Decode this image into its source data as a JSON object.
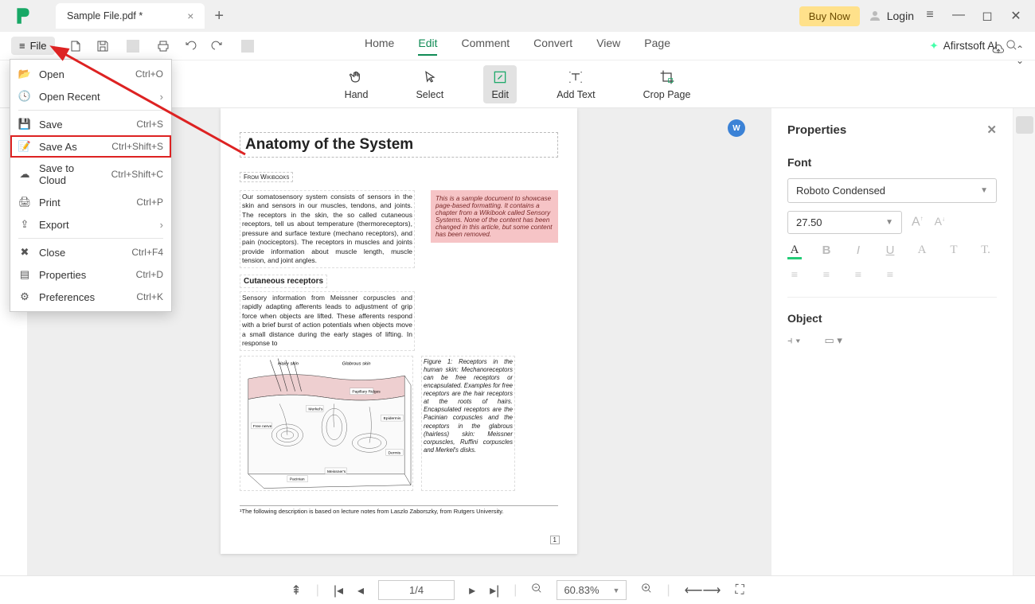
{
  "titlebar": {
    "tab_title": "Sample File.pdf *",
    "new_tab": "+",
    "buy": "Buy Now",
    "login": "Login"
  },
  "toolbar": {
    "file": "File"
  },
  "menubar": {
    "home": "Home",
    "edit": "Edit",
    "comment": "Comment",
    "convert": "Convert",
    "view": "View",
    "page": "Page",
    "ai": "Afirstsoft AI"
  },
  "ribbon": {
    "hand": "Hand",
    "select": "Select",
    "edit": "Edit",
    "add_text": "Add Text",
    "crop": "Crop Page"
  },
  "file_menu": {
    "open": {
      "label": "Open",
      "shortcut": "Ctrl+O"
    },
    "open_recent": {
      "label": "Open Recent"
    },
    "save": {
      "label": "Save",
      "shortcut": "Ctrl+S"
    },
    "save_as": {
      "label": "Save As",
      "shortcut": "Ctrl+Shift+S"
    },
    "save_cloud": {
      "label": "Save to Cloud",
      "shortcut": "Ctrl+Shift+C"
    },
    "print": {
      "label": "Print",
      "shortcut": "Ctrl+P"
    },
    "export": {
      "label": "Export"
    },
    "close": {
      "label": "Close",
      "shortcut": "Ctrl+F4"
    },
    "properties": {
      "label": "Properties",
      "shortcut": "Ctrl+D"
    },
    "preferences": {
      "label": "Preferences",
      "shortcut": "Ctrl+K"
    }
  },
  "document": {
    "title": "Anatomy of the System",
    "source": "From Wikibooks",
    "para1": "Our somatosensory system consists of sensors in the skin and sensors in our muscles, tendons, and joints. The receptors in the skin, the so called cutaneous receptors, tell us about temperature (thermoreceptors), pressure and surface texture (mechano receptors), and pain (nociceptors). The receptors in muscles and joints provide information about muscle length, muscle tension, and joint angles.",
    "note": "This is a sample document to showcase page-based formatting. It contains a chapter from a Wikibook called Sensory Systems. None of the content has been changed in this article, but some content has been removed.",
    "subhead": "Cutaneous receptors",
    "para2": "Sensory information from Meissner corpuscles and rapidly adapting afferents leads to adjustment of grip force when objects are lifted. These afferents respond with a brief burst of action potentials when objects move a small distance during the early stages of lifting. In response to",
    "fig_caption": "Figure 1:  Receptors in the human skin: Mechanoreceptors can be free receptors or encapsulated. Examples for free receptors are the hair receptors at the roots of hairs. Encapsulated receptors are the Pacinian corpuscles and the receptors in the glabrous (hairless) skin: Meissner corpuscles, Ruffini corpuscles and Merkel's disks.",
    "footnote": "¹The following description is based on lecture notes from Laszlo Zaborszky, from Rutgers University.",
    "page_badge": "1"
  },
  "properties": {
    "title": "Properties",
    "font_label": "Font",
    "font_value": "Roboto Condensed",
    "size_value": "27.50",
    "object_label": "Object"
  },
  "status": {
    "page": "1/4",
    "zoom": "60.83%"
  }
}
